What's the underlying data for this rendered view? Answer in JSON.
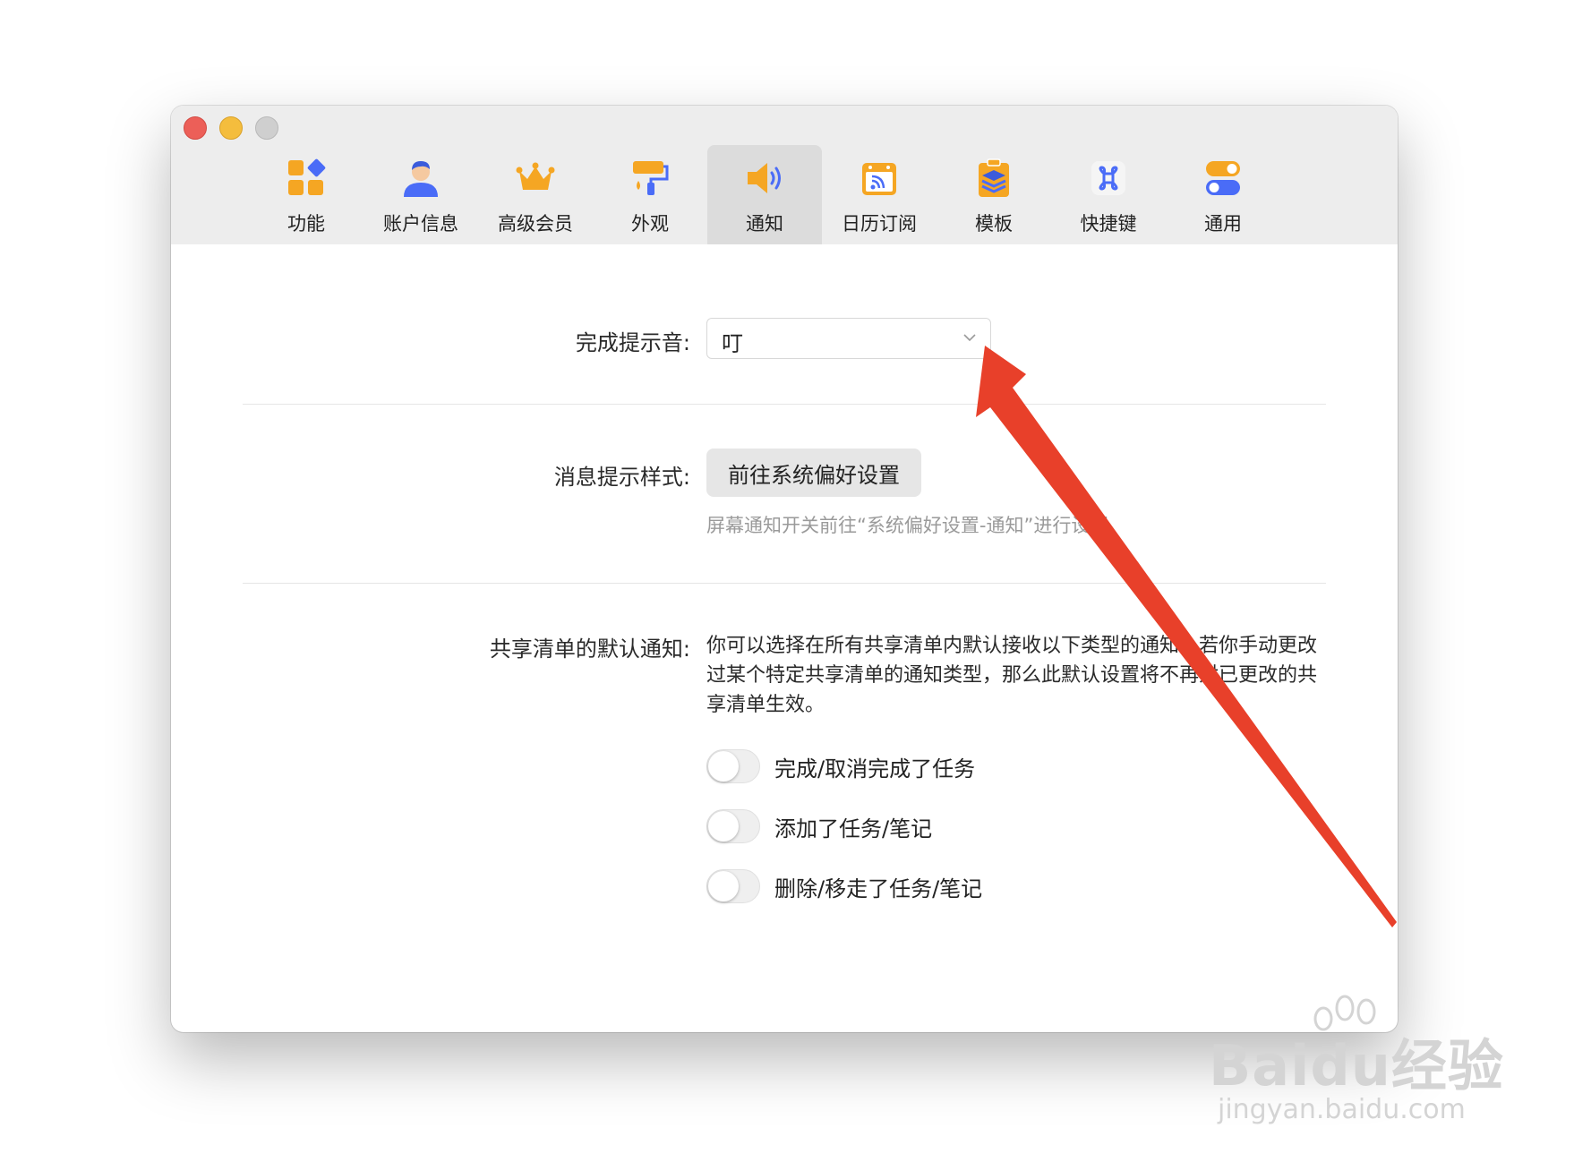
{
  "toolbar": {
    "items": [
      {
        "label": "功能",
        "icon": "feature-grid-icon"
      },
      {
        "label": "账户信息",
        "icon": "account-user-icon"
      },
      {
        "label": "高级会员",
        "icon": "crown-icon"
      },
      {
        "label": "外观",
        "icon": "paint-roller-icon"
      },
      {
        "label": "通知",
        "icon": "speaker-icon",
        "active": true
      },
      {
        "label": "日历订阅",
        "icon": "calendar-rss-icon"
      },
      {
        "label": "模板",
        "icon": "template-layers-icon"
      },
      {
        "label": "快捷键",
        "icon": "command-key-icon"
      },
      {
        "label": "通用",
        "icon": "toggle-switches-icon"
      }
    ]
  },
  "sound": {
    "label": "完成提示音:",
    "value": "叮"
  },
  "message_style": {
    "label": "消息提示样式:",
    "button": "前往系统偏好设置",
    "hint": "屏幕通知开关前往“系统偏好设置-通知”进行设置"
  },
  "shared_list": {
    "label": "共享清单的默认通知:",
    "description": "你可以选择在所有共享清单内默认接收以下类型的通知。若你手动更改过某个特定共享清单的通知类型，那么此默认设置将不再对已更改的共享清单生效。",
    "options": [
      {
        "label": "完成/取消完成了任务",
        "on": false
      },
      {
        "label": "添加了任务/笔记",
        "on": false
      },
      {
        "label": "删除/移走了任务/笔记",
        "on": false
      }
    ]
  },
  "watermark": {
    "brand": "Baidu经验",
    "url": "jingyan.baidu.com"
  },
  "colors": {
    "accent_orange": "#f5a623",
    "accent_blue": "#4a6cf7",
    "annotation_arrow": "#e8402a"
  }
}
